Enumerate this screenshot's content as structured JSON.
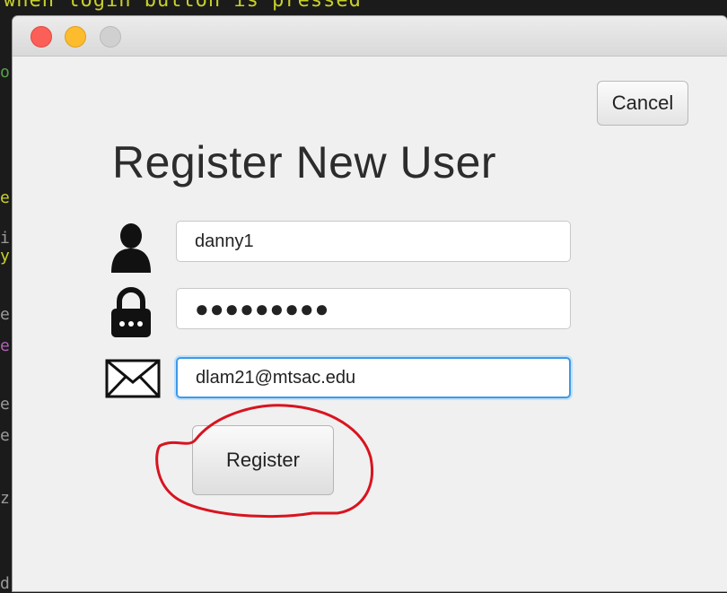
{
  "background": {
    "code_top_line": "when login button is pressed"
  },
  "window": {
    "buttons": {
      "cancel_label": "Cancel",
      "register_label": "Register"
    },
    "title": "Register New User",
    "form": {
      "username_value": "danny1",
      "password_masked": "●●●●●●●●●",
      "email_value": "dlam21@mtsac.edu"
    },
    "icons": {
      "username": "user-icon",
      "password": "lock-icon",
      "email": "envelope-icon"
    }
  },
  "annotation": {
    "color": "#d8141f",
    "shape": "hand-drawn circle around Register button"
  }
}
